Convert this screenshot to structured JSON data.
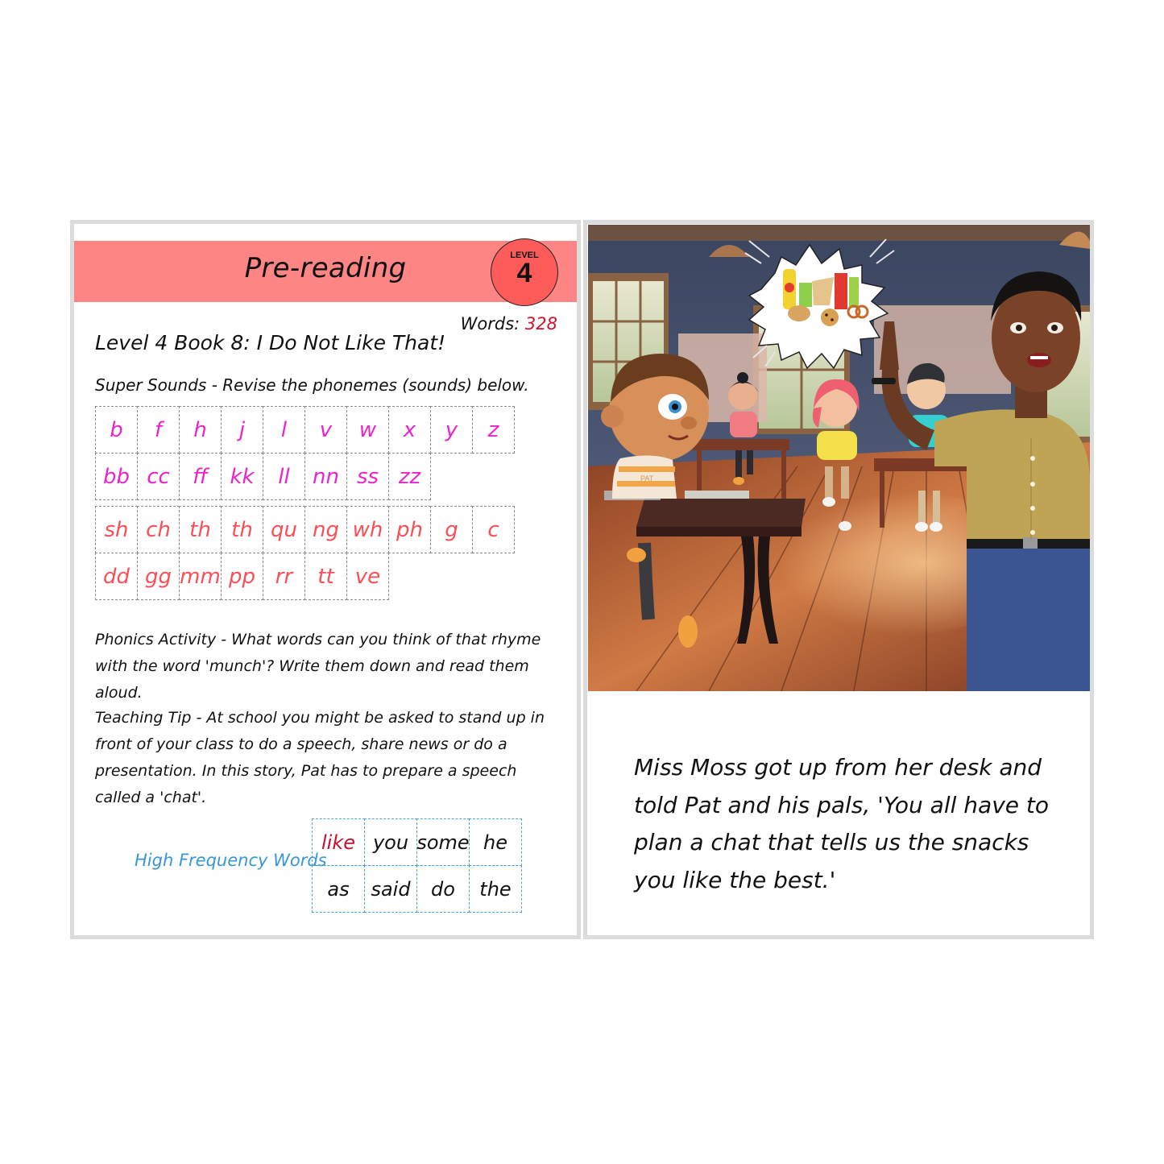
{
  "left_page": {
    "header": {
      "title": "Pre-reading",
      "band_color": "#fd8584",
      "level_badge": {
        "label": "LEVEL",
        "number": "4",
        "color": "#fd5c5b"
      }
    },
    "words": {
      "label": "Words:",
      "count": "328"
    },
    "book_title": "Level 4 Book 8: I Do Not Like That!",
    "super_sounds": {
      "instruction": "Super Sounds - Revise the phonemes (sounds) below.",
      "group_a": {
        "color": "#ec23cc",
        "rows": [
          [
            "b",
            "f",
            "h",
            "j",
            "l",
            "v",
            "w",
            "x",
            "y",
            "z"
          ],
          [
            "bb",
            "cc",
            "ff",
            "kk",
            "ll",
            "nn",
            "ss",
            "zz"
          ]
        ]
      },
      "group_b": {
        "color": "#fb4f57",
        "rows": [
          [
            "sh",
            "ch",
            "th",
            "th",
            "qu",
            "ng",
            "wh",
            "ph",
            "g",
            "c"
          ],
          [
            "dd",
            "gg",
            "mm",
            "pp",
            "rr",
            "tt",
            "ve"
          ]
        ]
      }
    },
    "phonics_activity": "Phonics Activity - What words can you think of that rhyme with the word 'munch'? Write them down and read them aloud.",
    "teaching_tip": "Teaching Tip - At school you might be asked to stand up in front of your class to do a speech, share news or do a presentation. In this story, Pat has to prepare a speech called a 'chat'.",
    "high_frequency_words": {
      "label": "High Frequency Words",
      "label_color": "#3a97d4",
      "highlight_color": "#c8102e",
      "rows": [
        [
          "like",
          "you",
          "some",
          "he"
        ],
        [
          "as",
          "said",
          "do",
          "the"
        ]
      ],
      "highlighted": [
        "like"
      ]
    }
  },
  "right_page": {
    "illustration": {
      "description": "Classroom scene: teacher Miss Moss pointing up with a speech bubble of snacks; Pat and classmates at desks",
      "shirt_label": "PAT",
      "speech_bubble_items": [
        "sauce-bottle",
        "chips-bag",
        "sandwich",
        "candy-bar",
        "muffin",
        "cookie",
        "pretzel"
      ]
    },
    "story_text": "Miss Moss got up from her desk and told Pat and his pals, 'You all have to plan a chat that tells us the snacks you like the best.'"
  }
}
